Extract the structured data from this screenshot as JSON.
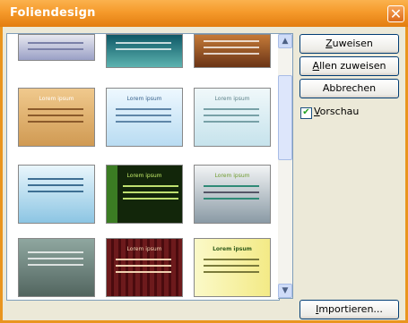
{
  "window": {
    "title": "Foliendesign"
  },
  "buttons": {
    "assign_mnemonic": "Z",
    "assign_rest": "uweisen",
    "assign_all_mnemonic": "A",
    "assign_all_rest": "llen zuweisen",
    "cancel": "Abbrechen",
    "import_mnemonic": "I",
    "import_rest": "mportieren..."
  },
  "preview": {
    "mnemonic": "V",
    "rest": "orschau",
    "checked": true
  },
  "gallery": {
    "thumbnails": [
      {
        "title": "",
        "bg": "#c9cfe0"
      },
      {
        "title": "",
        "bg": "#1e6e78"
      },
      {
        "title": "",
        "bg": "#a6622c"
      },
      {
        "title": "Lorem ipsum",
        "bg": "#e3b777"
      },
      {
        "title": "Lorem ipsum",
        "bg": "#d6ecfa"
      },
      {
        "title": "Lorem ipsum",
        "bg": "#dceef4"
      },
      {
        "title": "",
        "bg": "#bfe1f3"
      },
      {
        "title": "Lorem ipsum",
        "bg": "#233f15"
      },
      {
        "title": "Lorem ipsum",
        "bg": "#c5cdd3"
      },
      {
        "title": "",
        "bg": "#788f88"
      },
      {
        "title": "Lorem ipsum",
        "bg": "#5c1114"
      },
      {
        "title": "Lorem ipsum",
        "bg": "#f7f3aa"
      }
    ]
  }
}
